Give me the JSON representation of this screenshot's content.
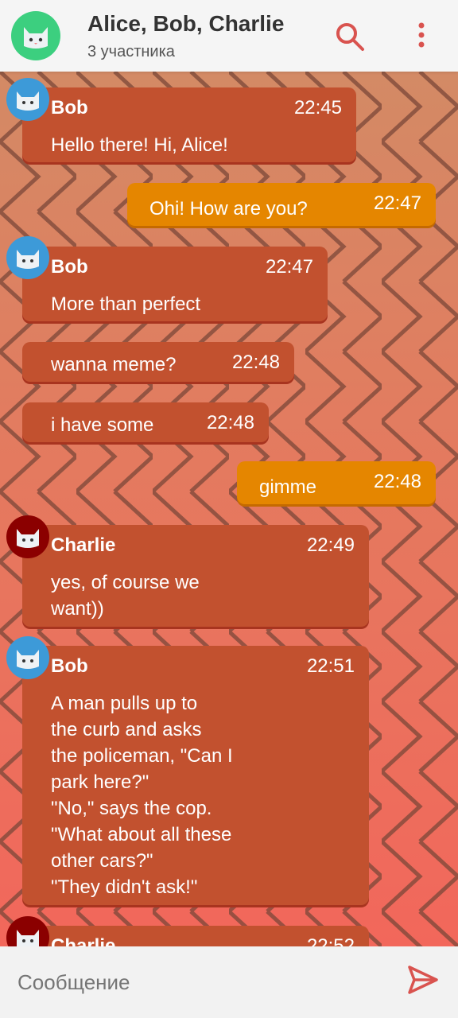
{
  "header": {
    "title": "Alice, Bob, Charlie",
    "subtitle": "3 участника",
    "avatar_color": "#3ccf7f",
    "search_icon": "search-icon",
    "menu_icon": "more-vertical-icon"
  },
  "messages": [
    {
      "sender": "Bob",
      "time": "22:45",
      "text": "Hello there! Hi, Alice!",
      "direction": "in"
    },
    {
      "time": "22:47",
      "text": "Ohi! How are you?",
      "direction": "out"
    },
    {
      "sender": "Bob",
      "time": "22:47",
      "text": "More than perfect",
      "direction": "in"
    },
    {
      "time": "22:48",
      "text": "wanna meme?",
      "direction": "in"
    },
    {
      "time": "22:48",
      "text": "i have some",
      "direction": "in"
    },
    {
      "time": "22:48",
      "text": "gimme",
      "direction": "out"
    },
    {
      "sender": "Charlie",
      "time": "22:49",
      "text": "yes, of course we\nwant))",
      "direction": "in"
    },
    {
      "sender": "Bob",
      "time": "22:51",
      "text": "A man pulls up to\nthe curb and asks\nthe policeman, \"Can I\npark here?\"\n\"No,\" says the cop.\n\"What about all these\nother cars?\"\n\"They didn't ask!\"",
      "direction": "in"
    },
    {
      "sender": "Charlie",
      "time": "22:52",
      "text": "",
      "direction": "in"
    }
  ],
  "input": {
    "placeholder": "Сообщение",
    "send_icon": "send-icon"
  },
  "colors": {
    "incoming_bubble": "#c2512f",
    "outgoing_bubble": "#e58600",
    "bob_avatar": "#3d9ad8",
    "charlie_avatar": "#8b0000",
    "accent": "#d9534f"
  }
}
